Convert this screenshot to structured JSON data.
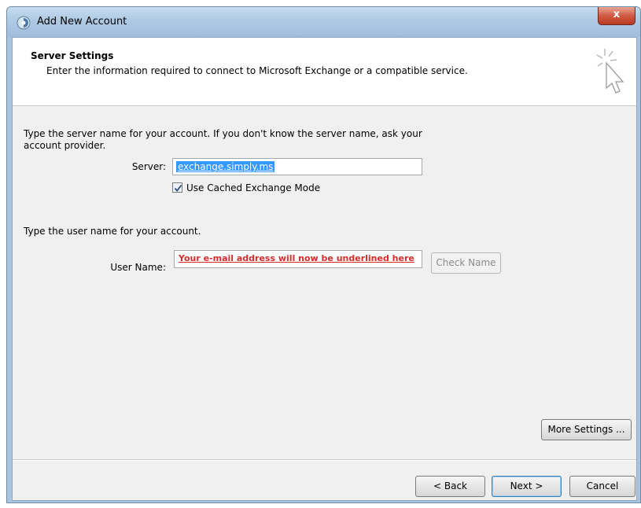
{
  "window": {
    "title": "Add New Account",
    "close_label": "x"
  },
  "header": {
    "title": "Server Settings",
    "subtitle": "Enter the information required to connect to Microsoft Exchange or a compatible service."
  },
  "server_section": {
    "instruction": "Type the server name for your account. If you don't know the server name, ask your account provider.",
    "server_label": "Server:",
    "server_value": "exchange.simply.ms",
    "cached_mode_label": "Use Cached Exchange Mode",
    "cached_mode_checked": true
  },
  "user_section": {
    "instruction": "Type the user name for your account.",
    "user_label": "User Name:",
    "user_value": "Your e-mail address will now be underlined here",
    "check_name_label": "Check Name"
  },
  "buttons": {
    "more_settings": "More Settings ...",
    "back": "< Back",
    "next": "Next >",
    "cancel": "Cancel"
  },
  "colors": {
    "selection": "#3399ff",
    "user_text": "#d62b2b",
    "close_button": "#c8452f"
  }
}
